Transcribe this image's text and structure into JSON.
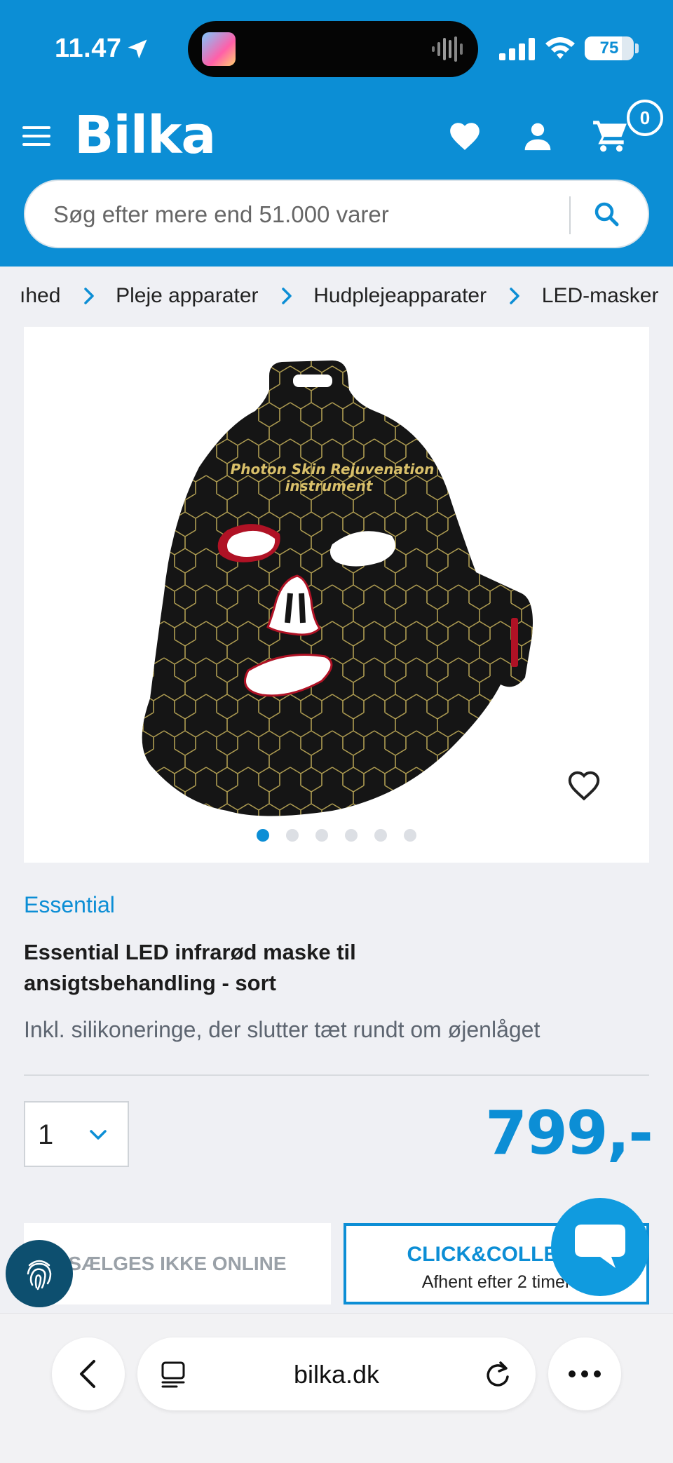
{
  "status_bar": {
    "time": "11.47",
    "battery": "75",
    "battery_level": 0.75
  },
  "header": {
    "logo": "Bilka",
    "cart_count": "0",
    "search_placeholder": "Søg efter mere end 51.000 varer",
    "brand_color": "#0c8ed5"
  },
  "breadcrumb": {
    "items": [
      "ıhed",
      "Pleje apparater",
      "Hudplejeapparater",
      "LED-masker"
    ]
  },
  "product": {
    "image_text_line1": "Photon Skin Rejuvenation",
    "image_text_line2": "instrument",
    "image_count": 6,
    "active_image": 1,
    "brand": "Essential",
    "title": "Essential LED infrarød maske til ansigtsbehandling - sort",
    "subtitle": "Inkl. silikoneringe, der slutter tæt rundt om øjenlåget",
    "quantity": "1",
    "price": "799,-"
  },
  "actions": {
    "online_label": "SÆLGES IKKE ONLINE",
    "click_collect_title": "CLICK&COLLECT",
    "click_collect_sub": "Afhent efter 2 timer"
  },
  "browser": {
    "domain": "bilka.dk"
  }
}
